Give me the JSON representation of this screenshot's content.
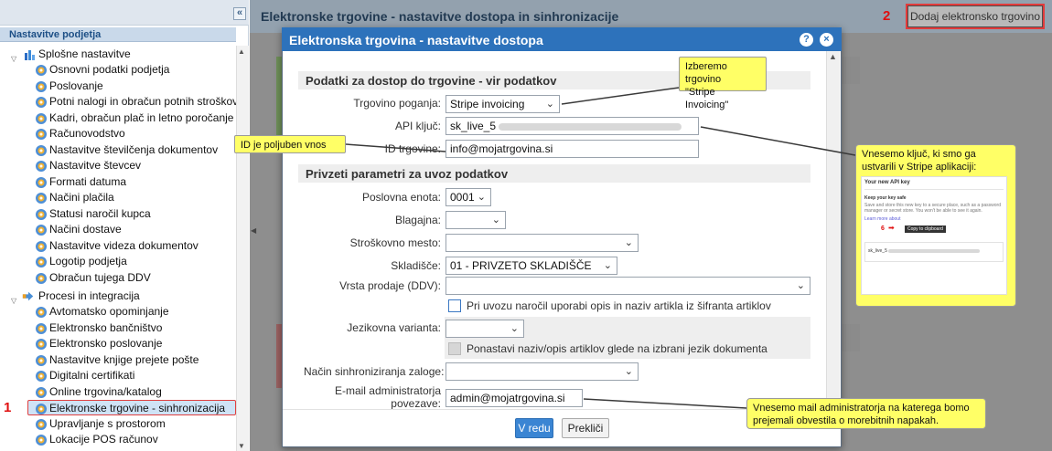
{
  "sidebar": {
    "collapse_glyph": "«",
    "title": "Nastavitve podjetja",
    "groups": [
      {
        "label": "Splošne nastavitve",
        "items": [
          "Osnovni podatki podjetja",
          "Poslovanje",
          "Potni nalogi in obračun potnih stroškov",
          "Kadri, obračun plač in letno poročanje",
          "Računovodstvo",
          "Nastavitve številčenja dokumentov",
          "Nastavitve števcev",
          "Formati datuma",
          "Načini plačila",
          "Statusi naročil kupca",
          "Načini dostave",
          "Nastavitve videza dokumentov",
          "Logotip podjetja",
          "Obračun tujega DDV"
        ]
      },
      {
        "label": "Procesi in integracija",
        "items": [
          "Avtomatsko opominjanje",
          "Elektronsko bančništvo",
          "Elektronsko poslovanje",
          "Nastavitve knjige prejete pošte",
          "Digitalni certifikati",
          "Online trgovina/katalog",
          "Elektronske trgovine - sinhronizacija",
          "Upravljanje s prostorom",
          "Lokacije POS računov"
        ]
      }
    ],
    "selected_marker": "1"
  },
  "main": {
    "title": "Elektronske trgovine - nastavitve dostopa in sinhronizacije",
    "add_button": "Dodaj elektronsko trgovino",
    "add_marker": "2"
  },
  "dialog": {
    "title": "Elektronska trgovina - nastavitve dostopa",
    "help": "?",
    "close": "×",
    "section1": "Podatki za dostop do trgovine - vir podatkov",
    "section2": "Privzeti parametri za uvoz podatkov",
    "fields": {
      "engine_label": "Trgovino poganja:",
      "engine_value": "Stripe invoicing",
      "api_label": "API ključ:",
      "api_value": "sk_live_5",
      "id_label": "ID trgovine:",
      "id_value": "info@mojatrgovina.si",
      "unit_label": "Poslovna enota:",
      "unit_value": "0001",
      "cash_label": "Blagajna:",
      "cost_label": "Stroškovno mesto:",
      "warehouse_label": "Skladišče:",
      "warehouse_value": "01 - PRIVZETO SKLADIŠČE",
      "sale_label": "Vrsta prodaje (DDV):",
      "chk1_label": "Pri uvozu naročil uporabi opis in naziv artikla iz šifranta artiklov",
      "lang_label": "Jezikovna varianta:",
      "chk2_label": "Ponastavi naziv/opis artiklov glede na izbrani jezik dokumenta",
      "stock_label": "Način sinhroniziranja zaloge:",
      "email_label_1": "E-mail administratorja",
      "email_label_2": "povezave:",
      "email_value": "admin@mojatrgovina.si"
    },
    "ok": "V redu",
    "cancel": "Prekliči"
  },
  "callouts": {
    "engine": [
      "Izberemo trgovino",
      "\"Stripe Invoicing\""
    ],
    "id": "ID je poljuben vnos",
    "key": [
      "Vnesemo ključ, ki smo ga",
      "ustvarili v Stripe  aplikaciji:"
    ],
    "email": [
      "Vnesemo mail administratorja na katerega bomo",
      "prejemali obvestila o morebitnih napakah."
    ]
  },
  "stripe_key_panel": {
    "title": "Your new API key",
    "subtitle": "Keep your key safe",
    "body": "Save and store this new key to a secure place, such as a password manager or secret store. You won't be able to see it again.",
    "link": "Learn more about",
    "marker": "6",
    "copy": "Copy to clipboard",
    "key_prefix": "sk_live_5"
  },
  "colors": {
    "header": "#2d72bb",
    "marker": "#e01010",
    "callout": "#ffff66",
    "accent": "#3a85d3"
  }
}
